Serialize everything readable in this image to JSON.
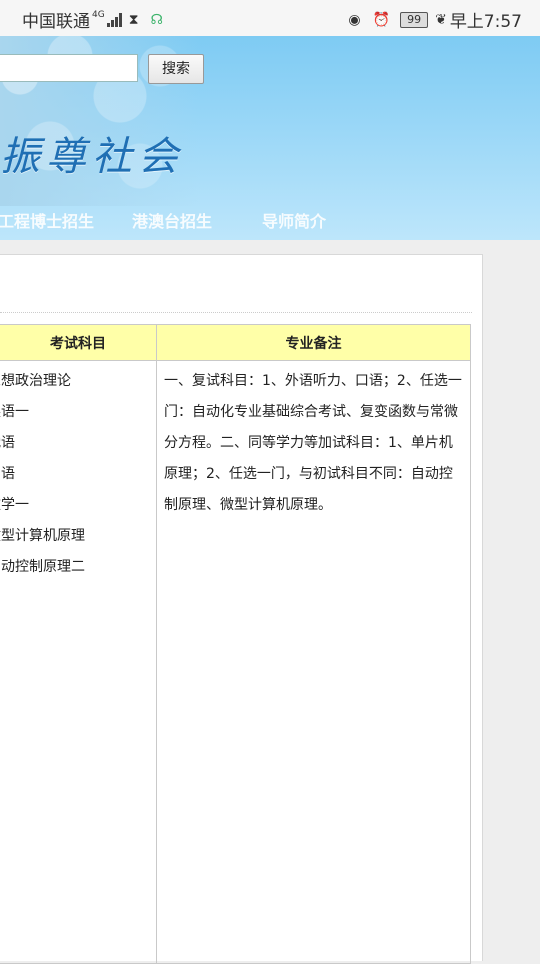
{
  "status_bar": {
    "carrier": "中国联通",
    "network": "4G",
    "battery": "99",
    "time": "早上7:57"
  },
  "header": {
    "search_button": "搜索",
    "calligraphy": "振尊社会",
    "nav": [
      "工程博士招生",
      "港澳台招生",
      "导师简介"
    ]
  },
  "table": {
    "headers": [
      "考试科目",
      "专业备注"
    ],
    "subjects": [
      "思想政治理论",
      "英语一",
      "俄语",
      "日语",
      "数学一",
      "微型计算机原理",
      "自动控制原理二"
    ],
    "note": "一、复试科目：1、外语听力、口语；2、任选一门：自动化专业基础综合考试、复变函数与常微分方程。二、同等学力等加试科目：1、单片机原理；2、任选一门，与初试科目不同：自动控制原理、微型计算机原理。"
  }
}
